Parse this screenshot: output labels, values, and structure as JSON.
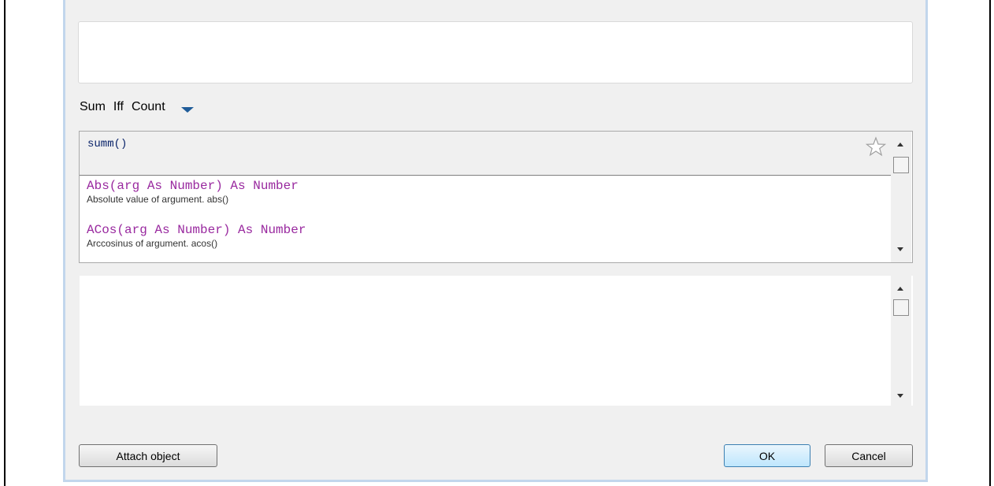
{
  "quick_functions": [
    "Sum",
    "Iff",
    "Count"
  ],
  "icons": {
    "dropdown": "chevron-down-icon",
    "favorite": "star-icon",
    "scroll_up": "arrow-up-icon",
    "scroll_down": "arrow-down-icon"
  },
  "function_list": {
    "current_query": "summ()",
    "items": [
      {
        "signature": "Abs(arg As Number) As Number",
        "description": "Absolute value of argument. abs()"
      },
      {
        "signature": "ACos(arg As Number) As Number",
        "description": "Arccosinus of argument. acos()"
      }
    ]
  },
  "buttons": {
    "attach": "Attach object",
    "ok": "OK",
    "cancel": "Cancel"
  },
  "colors": {
    "signature": "#99299f",
    "query": "#0a246a",
    "dropdown_arrow": "#1f5c99",
    "dialog_border": "#c2d6ec"
  }
}
